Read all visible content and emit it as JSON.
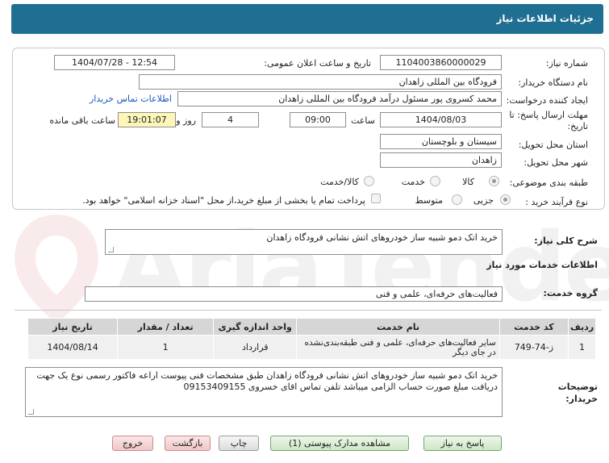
{
  "header": {
    "title": "جزئیات اطلاعات نیاز"
  },
  "form": {
    "need_number_label": "شماره نیاز:",
    "need_number": "1104003860000029",
    "announce_label": "تاریخ و ساعت اعلان عمومی:",
    "announce_value": "1404/07/28 - 12:54",
    "buyer_label": "نام دستگاه خریدار:",
    "buyer_value": "فرودگاه بین المللی زاهدان",
    "requester_label": "ایجاد کننده درخواست:",
    "requester_value": "محمد کسروی پور مسئول درآمد فرودگاه بین المللی زاهدان",
    "contact_link": "اطلاعات تماس خریدار",
    "deadline_label_1": "مهلت ارسال پاسخ: تا",
    "deadline_label_2": "تاریخ:",
    "deadline_date": "1404/08/03",
    "time_label": "ساعت",
    "deadline_time": "09:00",
    "days_value": "4",
    "days_label": "روز و",
    "remaining_time": "19:01:07",
    "remaining_label": "ساعت باقی مانده",
    "province_label": "استان محل تحویل:",
    "province_value": "سیستان و بلوچستان",
    "city_label": "شهر محل تحویل:",
    "city_value": "زاهدان",
    "category_label": "طبقه بندی موضوعی:",
    "category_options": [
      "کالا",
      "خدمت",
      "کالا/خدمت"
    ],
    "process_label": "نوع فرآیند خرید :",
    "process_options": [
      "جزیی",
      "متوسط"
    ],
    "payment_note": "پرداخت تمام یا بخشی از مبلغ خرید،از محل \"اسناد خزانه اسلامی\" خواهد بود."
  },
  "need_summary": {
    "label": "شرح کلی نیاز:",
    "value": "خرید اتک دمو شبیه ساز خودروهای اتش نشانی فرودگاه زاهدان"
  },
  "services": {
    "section_title": "اطلاعات خدمات مورد نیاز",
    "group_label": "گروه خدمت:",
    "group_value": "فعالیت‌های حرفه‌ای، علمی و فنی",
    "columns": [
      "ردیف",
      "کد خدمت",
      "نام خدمت",
      "واحد اندازه گیری",
      "تعداد / مقدار",
      "تاریخ نیاز"
    ],
    "rows": [
      {
        "row": "1",
        "code": "ز-74-749",
        "name": "سایر فعالیت‌های حرفه‌ای، علمی و فنی طبقه‌بندی‌نشده در جای دیگر",
        "unit": "قرارداد",
        "qty": "1",
        "date": "1404/08/14"
      }
    ]
  },
  "buyer_notes": {
    "label_1": "توضیحات",
    "label_2": "خریدار:",
    "value": "خرید اتک دمو شبیه ساز خودروهای اتش نشانی فرودگاه زاهدان طبق مشخصات فنی پیوست  اراعه فاکتور رسمی نوع یک جهت دریافت مبلغ صورت حساب الزامی میباشد تلفن تماس اقای خسروی 09153409155"
  },
  "buttons": {
    "reply": "پاسخ به نیاز",
    "view_docs": "مشاهده مدارک پیوستی (1)",
    "print": "چاپ",
    "back": "بازگشت",
    "exit": "خروج"
  },
  "watermark": {
    "text": "AriaTender.net"
  },
  "colors": {
    "header": "#1f6f93",
    "link": "#1a56c4",
    "highlight": "#fdf6b8"
  }
}
